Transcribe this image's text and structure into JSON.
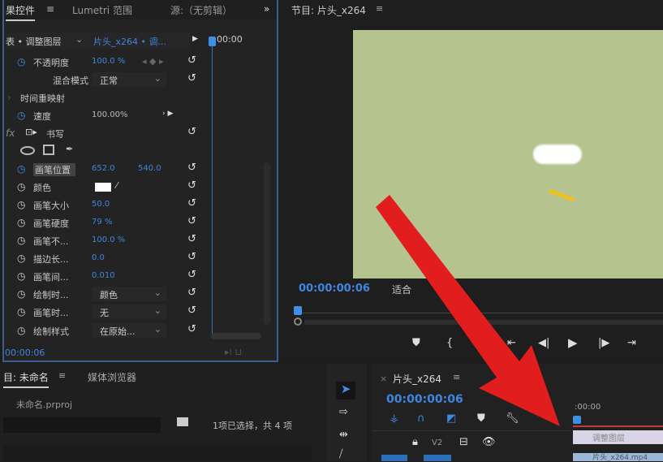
{
  "effect_controls": {
    "tab_label": "果控件",
    "tab_lumetri": "Lumetri 范围",
    "tab_source": "源:（无剪辑）",
    "overflow": "»",
    "master": "表 • 调整图层",
    "clip": "片头_x264 • 调...",
    "timecode_head": "00:00",
    "rows": [
      {
        "label": "不透明度",
        "value": "100.0 %"
      },
      {
        "label": "混合模式",
        "value": "正常"
      },
      {
        "label": "时间重映射"
      },
      {
        "label": "速度",
        "value": "100.00%"
      },
      {
        "label": "书写",
        "fx": "fx"
      },
      {
        "label": "画笔位置",
        "value": "652.0",
        "value2": "540.0"
      },
      {
        "label": "颜色"
      },
      {
        "label": "画笔大小",
        "value": "50.0"
      },
      {
        "label": "画笔硬度",
        "value": "79 %"
      },
      {
        "label": "画笔不...",
        "value": "100.0 %"
      },
      {
        "label": "描边长...",
        "value": "0.0"
      },
      {
        "label": "画笔间...",
        "value": "0.010"
      },
      {
        "label": "绘制时...",
        "value": "颜色"
      },
      {
        "label": "画笔时...",
        "value": "无"
      },
      {
        "label": "绘制样式",
        "value": "在原始..."
      }
    ],
    "timecode": "00:00:06"
  },
  "program": {
    "title": "节目: 片头_x264",
    "timecode": "00:00:00:06",
    "fit": "适合"
  },
  "project": {
    "tab": "目: 未命名",
    "tab_media": "媒体浏览器",
    "file": "未命名.prproj",
    "status": "1项已选择，共 4 项"
  },
  "timeline": {
    "title": "片头_x264",
    "timecode": "00:00:00:06",
    "ruler": ":00:00",
    "track": "V2",
    "clip1": "调整图层",
    "clip2": "片头_x264.mp4"
  },
  "colors": {
    "accent": "#3f86df",
    "frame": "#b5c38e",
    "arrow": "#e21d1d"
  }
}
